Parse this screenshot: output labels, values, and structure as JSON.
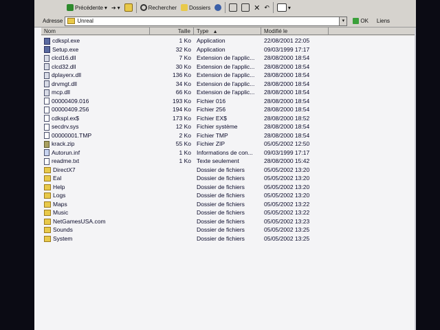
{
  "toolbar": {
    "back_label": "Précédente",
    "search_label": "Rechercher",
    "folders_label": "Dossiers"
  },
  "address": {
    "label": "Adresse",
    "value": "Unreal",
    "go_label": "OK",
    "links_label": "Liens"
  },
  "columns": {
    "name": "Nom",
    "size": "Taille",
    "type": "Type",
    "modified": "Modifié le"
  },
  "files": [
    {
      "name": "cdkspl.exe",
      "size": "1 Ko",
      "type": "Application",
      "modified": "22/08/2001 22:05",
      "icon": "app"
    },
    {
      "name": "Setup.exe",
      "size": "32 Ko",
      "type": "Application",
      "modified": "09/03/1999 17:17",
      "icon": "app"
    },
    {
      "name": "clcd16.dll",
      "size": "7 Ko",
      "type": "Extension de l'applic...",
      "modified": "28/08/2000 18:54",
      "icon": "dll"
    },
    {
      "name": "clcd32.dll",
      "size": "30 Ko",
      "type": "Extension de l'applic...",
      "modified": "28/08/2000 18:54",
      "icon": "dll"
    },
    {
      "name": "dplayerx.dll",
      "size": "136 Ko",
      "type": "Extension de l'applic...",
      "modified": "28/08/2000 18:54",
      "icon": "dll"
    },
    {
      "name": "drvmgt.dll",
      "size": "34 Ko",
      "type": "Extension de l'applic...",
      "modified": "28/08/2000 18:54",
      "icon": "dll"
    },
    {
      "name": "mcp.dll",
      "size": "66 Ko",
      "type": "Extension de l'applic...",
      "modified": "28/08/2000 18:54",
      "icon": "dll"
    },
    {
      "name": "00000409.016",
      "size": "193 Ko",
      "type": "Fichier 016",
      "modified": "28/08/2000 18:54",
      "icon": "file"
    },
    {
      "name": "00000409.256",
      "size": "194 Ko",
      "type": "Fichier 256",
      "modified": "28/08/2000 18:54",
      "icon": "file"
    },
    {
      "name": "cdkspl.ex$",
      "size": "173 Ko",
      "type": "Fichier EX$",
      "modified": "28/08/2000 18:52",
      "icon": "file"
    },
    {
      "name": "secdrv.sys",
      "size": "12 Ko",
      "type": "Fichier système",
      "modified": "28/08/2000 18:54",
      "icon": "file"
    },
    {
      "name": "00000001.TMP",
      "size": "2 Ko",
      "type": "Fichier TMP",
      "modified": "28/08/2000 18:54",
      "icon": "file"
    },
    {
      "name": "krack.zip",
      "size": "55 Ko",
      "type": "Fichier ZIP",
      "modified": "05/05/2002 12:50",
      "icon": "zip"
    },
    {
      "name": "Autorun.inf",
      "size": "1 Ko",
      "type": "Informations de con...",
      "modified": "09/03/1999 17:17",
      "icon": "inf"
    },
    {
      "name": "readme.txt",
      "size": "1 Ko",
      "type": "Texte seulement",
      "modified": "28/08/2000 15:42",
      "icon": "file"
    },
    {
      "name": "DirectX7",
      "size": "",
      "type": "Dossier de fichiers",
      "modified": "05/05/2002 13:20",
      "icon": "folder"
    },
    {
      "name": "Eal",
      "size": "",
      "type": "Dossier de fichiers",
      "modified": "05/05/2002 13:20",
      "icon": "folder"
    },
    {
      "name": "Help",
      "size": "",
      "type": "Dossier de fichiers",
      "modified": "05/05/2002 13:20",
      "icon": "folder"
    },
    {
      "name": "Logs",
      "size": "",
      "type": "Dossier de fichiers",
      "modified": "05/05/2002 13:20",
      "icon": "folder"
    },
    {
      "name": "Maps",
      "size": "",
      "type": "Dossier de fichiers",
      "modified": "05/05/2002 13:22",
      "icon": "folder"
    },
    {
      "name": "Music",
      "size": "",
      "type": "Dossier de fichiers",
      "modified": "05/05/2002 13:22",
      "icon": "folder"
    },
    {
      "name": "NetGamesUSA.com",
      "size": "",
      "type": "Dossier de fichiers",
      "modified": "05/05/2002 13:23",
      "icon": "folder"
    },
    {
      "name": "Sounds",
      "size": "",
      "type": "Dossier de fichiers",
      "modified": "05/05/2002 13:25",
      "icon": "folder"
    },
    {
      "name": "System",
      "size": "",
      "type": "Dossier de fichiers",
      "modified": "05/05/2002 13:25",
      "icon": "folder"
    }
  ],
  "colors": {
    "chrome": "#d6d3ce",
    "window_bg": "#f4f4f6",
    "text": "#0a0a2a"
  }
}
